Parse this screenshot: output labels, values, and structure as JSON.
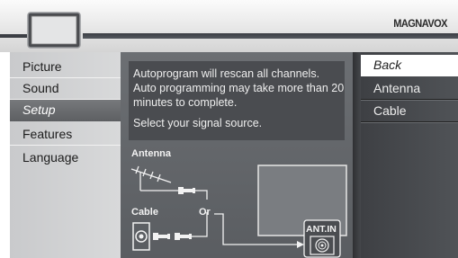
{
  "header": {
    "brand": "MAGNAVOX",
    "icon": "tv-icon"
  },
  "left_menu": {
    "items": [
      {
        "label": "Picture",
        "selected": false
      },
      {
        "label": "Sound",
        "selected": false
      },
      {
        "label": "Setup",
        "selected": true
      },
      {
        "label": "Features",
        "selected": false
      },
      {
        "label": "Language",
        "selected": false
      }
    ]
  },
  "info": {
    "lines": [
      "Autoprogram will rescan all channels.",
      "Auto programming may take more than 20",
      "minutes to complete."
    ],
    "source_prompt": "Select your signal source."
  },
  "diagram": {
    "antenna_label": "Antenna",
    "cable_label": "Cable",
    "or_label": "Or",
    "input_label": "ANT.IN"
  },
  "right_menu": {
    "items": [
      {
        "label": "Back",
        "selected": true
      },
      {
        "label": "Antenna",
        "selected": false
      },
      {
        "label": "Cable",
        "selected": false
      }
    ]
  },
  "colors": {
    "selected_left": "#66686b",
    "selected_right": "#ffffff",
    "panel_dark": "#3a3b3d",
    "menu_light": "#d0d1d3"
  }
}
